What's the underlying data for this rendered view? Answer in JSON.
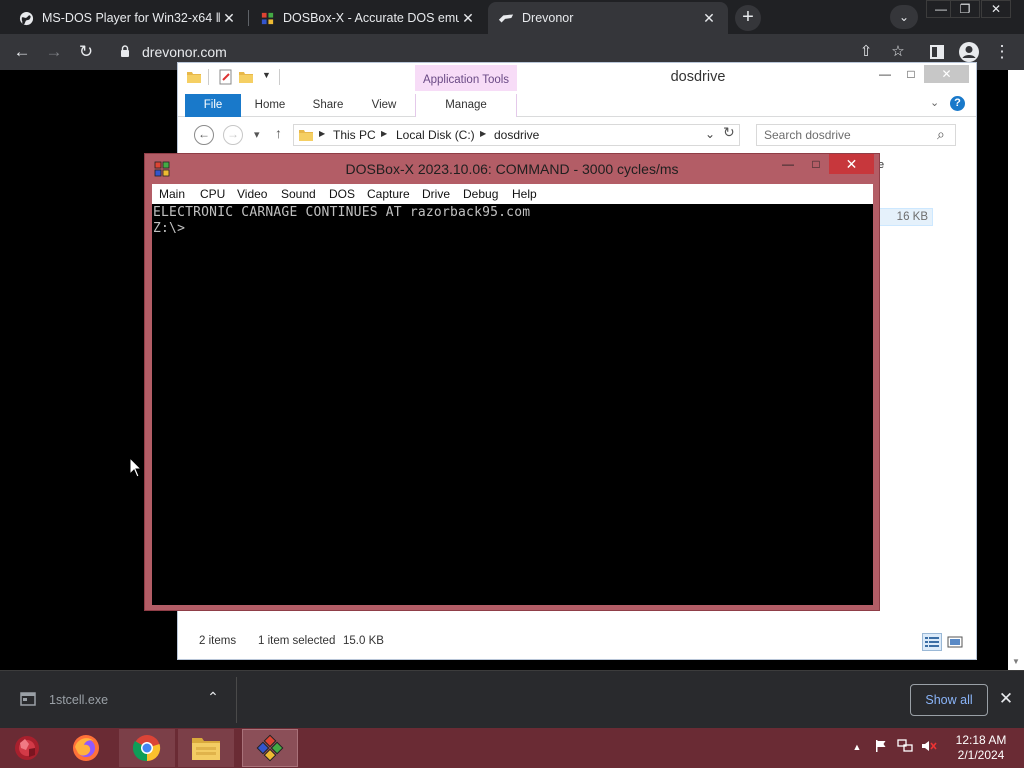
{
  "browser": {
    "tabs": [
      {
        "title": "MS-DOS Player for Win32-x64 ‖",
        "close": "✕",
        "favicon": "globe-icon"
      },
      {
        "title": "DOSBox-X - Accurate DOS emula",
        "close": "✕",
        "favicon": "dosbox-icon"
      },
      {
        "title": "Drevonor",
        "close": "✕",
        "favicon": "drevonor-icon"
      }
    ],
    "new_tab": "+",
    "tab_list": "⌄",
    "window_controls": {
      "minimize": "—",
      "maximize": "❐",
      "close": "✕"
    },
    "url": "drevonor.com",
    "nav": {
      "back": "←",
      "forward": "→",
      "reload": "↻"
    },
    "actions": {
      "share": "⇧",
      "bookmark": "☆",
      "menu": "⋮"
    }
  },
  "explorer": {
    "title": "dosdrive",
    "app_tools": "Application Tools",
    "ribbon_tabs": [
      "File",
      "Home",
      "Share",
      "View",
      "Manage"
    ],
    "breadcrumb": [
      "This PC",
      "Local Disk (C:)",
      "dosdrive"
    ],
    "search_placeholder": "Search dosdrive",
    "file_size_partial": "16 KB",
    "status": {
      "items": "2 items",
      "selected": "1 item selected",
      "size": "15.0 KB"
    },
    "controls": {
      "minimize": "—",
      "maximize": "□",
      "close": "✕"
    },
    "nav": {
      "back": "←",
      "forward": "→",
      "recent": "▾",
      "up": "↑",
      "dropdown": "⌄",
      "refresh": "↻",
      "search": "⌕",
      "ribbon_expand": "⌄",
      "help": "?"
    }
  },
  "dosbox": {
    "title": "DOSBox-X 2023.10.06: COMMAND - 3000 cycles/ms",
    "menu": [
      "Main",
      "CPU",
      "Video",
      "Sound",
      "DOS",
      "Capture",
      "Drive",
      "Debug",
      "Help"
    ],
    "screen_lines": [
      "ELECTRONIC CARNAGE CONTINUES AT razorback95.com",
      "Z:\\>"
    ],
    "controls": {
      "minimize": "—",
      "maximize": "□",
      "close": "✕"
    }
  },
  "downloads": {
    "file": "1stcell.exe",
    "caret": "⌃",
    "show_all": "Show all",
    "close": "✕"
  },
  "taskbar": {
    "apps": [
      "start-orb",
      "firefox",
      "chrome",
      "file-explorer",
      "dosbox-x"
    ],
    "tray": {
      "show_hidden": "▲"
    },
    "time": "12:18 AM",
    "date": "2/1/2024"
  },
  "colors": {
    "chrome_dark": "#202124",
    "dosbox_frame": "#b35d66",
    "taskbar": "#6a2b34",
    "file_tab": "#1979ca",
    "link": "#8ab4f8"
  }
}
